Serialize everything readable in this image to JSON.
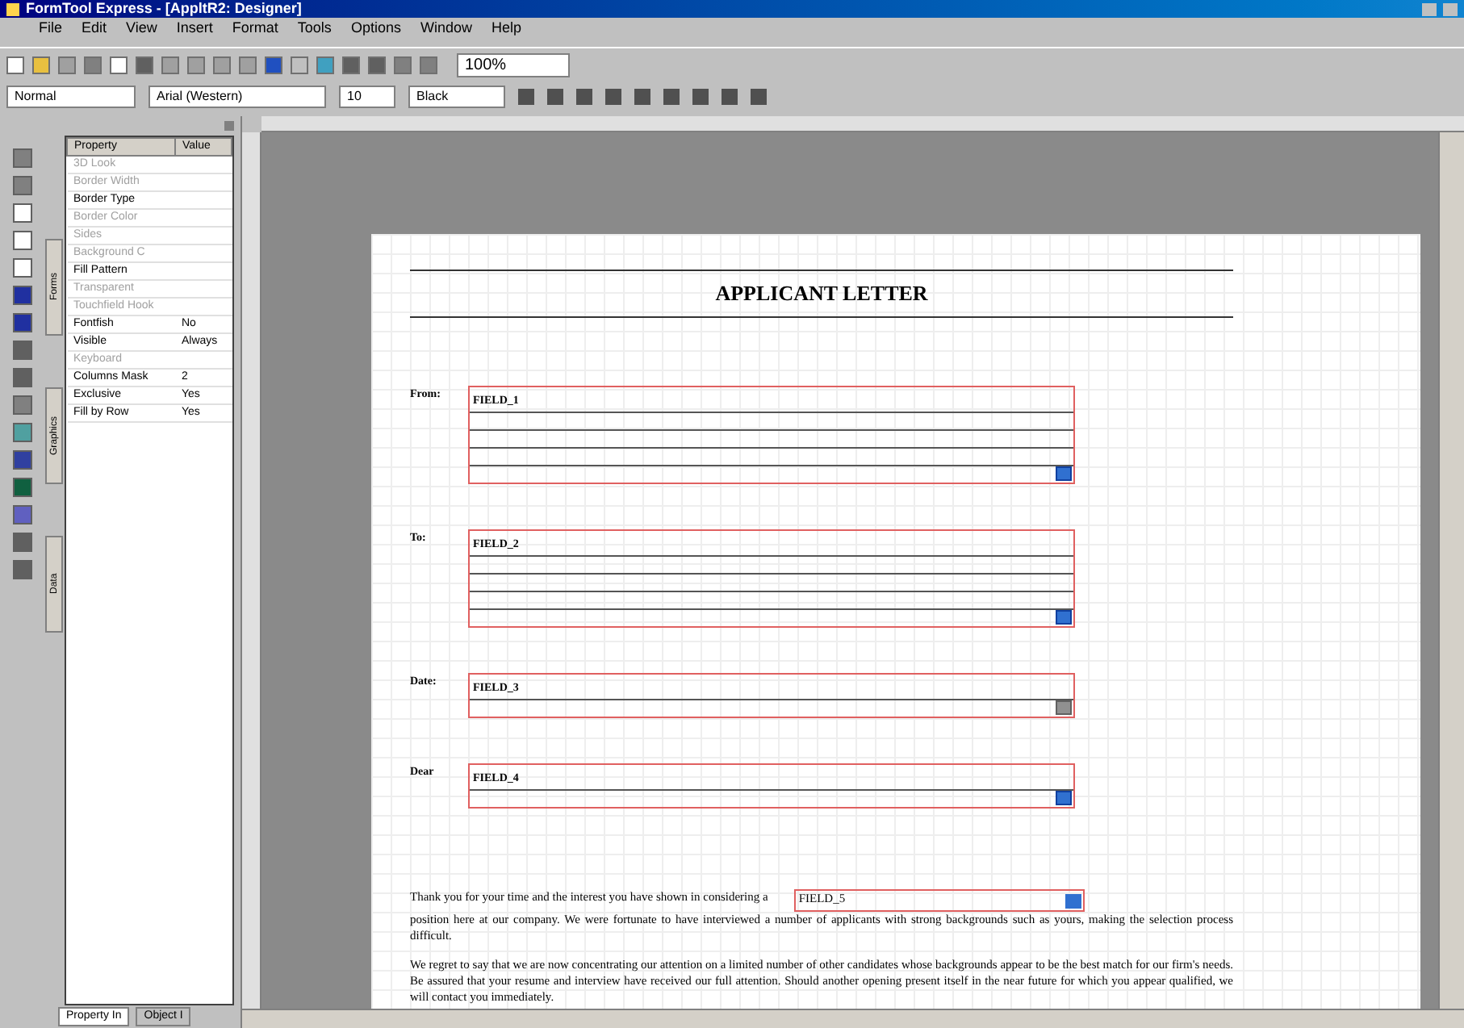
{
  "window": {
    "title": "FormTool Express - [AppltR2: Designer]"
  },
  "menu": [
    "File",
    "Edit",
    "View",
    "Insert",
    "Format",
    "Tools",
    "Options",
    "Window",
    "Help"
  ],
  "toolbar": {
    "zoom": "100%"
  },
  "format_bar": {
    "style": "Normal",
    "font": "Arial (Western)",
    "size": "10",
    "text_color": "Black"
  },
  "properties": {
    "columns": [
      "Property",
      "Value"
    ],
    "rows": [
      {
        "name": "3D Look",
        "value": "",
        "disabled": true
      },
      {
        "name": "Border Width",
        "value": "",
        "disabled": true
      },
      {
        "name": "Border Type",
        "value": "",
        "disabled": false
      },
      {
        "name": "Border Color",
        "value": "",
        "disabled": true
      },
      {
        "name": "Sides",
        "value": "",
        "disabled": true
      },
      {
        "name": "Background C",
        "value": "",
        "disabled": true
      },
      {
        "name": "Fill Pattern",
        "value": "",
        "disabled": false
      },
      {
        "name": "Transparent",
        "value": "",
        "disabled": true
      },
      {
        "name": "Touchfield Hook",
        "value": "",
        "disabled": true
      },
      {
        "name": "Fontfish",
        "value": "No",
        "disabled": false
      },
      {
        "name": "Visible",
        "value": "Always",
        "disabled": false
      },
      {
        "name": "Keyboard",
        "value": "",
        "disabled": true
      },
      {
        "name": "Columns Mask",
        "value": "2",
        "disabled": false
      },
      {
        "name": "Exclusive",
        "value": "Yes",
        "disabled": false
      },
      {
        "name": "Fill by Row",
        "value": "Yes",
        "disabled": false
      }
    ],
    "side_tabs": [
      "Forms",
      "Graphics",
      "Data"
    ],
    "bottom_tabs": [
      {
        "label": "Property In",
        "selected": true
      },
      {
        "label": "Object I",
        "selected": false
      }
    ]
  },
  "document": {
    "title": "APPLICANT LETTER",
    "fields": [
      {
        "label": "From:",
        "name": "FIELD_1",
        "kind": "multiline"
      },
      {
        "label": "To:",
        "name": "FIELD_2",
        "kind": "multiline"
      },
      {
        "label": "Date:",
        "name": "FIELD_3",
        "kind": "date"
      },
      {
        "label": "Dear",
        "name": "FIELD_4",
        "kind": "single"
      }
    ],
    "paragraph_1": {
      "before": "Thank you for your time and the interest you have shown in considering a",
      "field": "FIELD_5",
      "after": "position here at our company. We were fortunate to have interviewed a number of applicants with strong backgrounds such as yours, making the selection process difficult."
    },
    "paragraph_2": "We regret to say that we are now concentrating our attention on a limited number of other candidates whose backgrounds appear to be the best match for our firm's needs. Be assured that your resume and interview have received our full attention. Should another opening present itself in the near future for which you appear qualified, we will contact you immediately."
  }
}
